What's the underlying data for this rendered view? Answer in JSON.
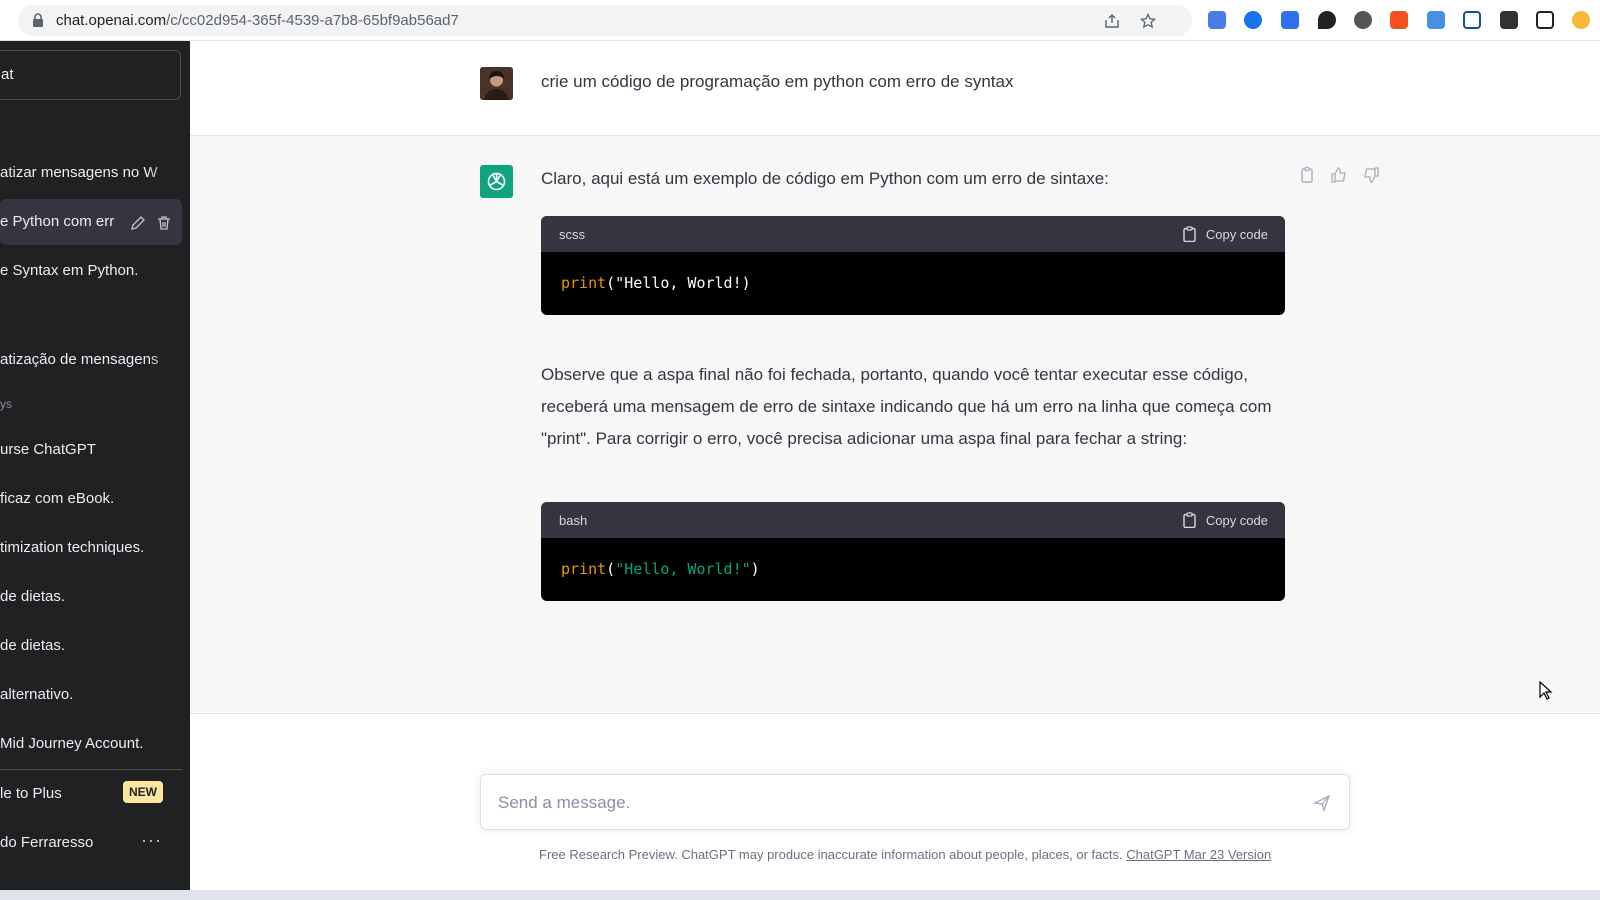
{
  "browser": {
    "url_host": "chat.openai.com",
    "url_path": "/c/cc02d954-365f-4539-a7b8-65bf9ab56ad7"
  },
  "sidebar": {
    "new_chat_label": "at",
    "items": [
      {
        "label": "atizar mensagens no W"
      },
      {
        "label": "e Python com err"
      },
      {
        "label": "e Syntax em Python."
      },
      {
        "label": "atização de mensagens"
      },
      {
        "label": "urse ChatGPT"
      },
      {
        "label": "ficaz com eBook."
      },
      {
        "label": "timization techniques."
      },
      {
        "label": "de dietas."
      },
      {
        "label": "de dietas."
      },
      {
        "label": "alternativo."
      },
      {
        "label": "Mid Journey Account."
      }
    ],
    "group_label": "ys",
    "upgrade_label": "le to Plus",
    "new_badge": "NEW",
    "user_name": "do Ferraresso",
    "more_label": "···"
  },
  "conversation": {
    "user_message": "crie um código de programação em python com erro de syntax",
    "bot_intro": "Claro, aqui está um exemplo de código em Python com um erro de sintaxe:",
    "code1": {
      "lang": "scss",
      "copy_label": "Copy code",
      "fn": "print",
      "rest": "(\"Hello, World!)"
    },
    "bot_paragraph": "Observe que a aspa final não foi fechada, portanto, quando você tentar executar esse código, receberá uma mensagem de erro de sintaxe indicando que há um erro na linha que começa com \"print\". Para corrigir o erro, você precisa adicionar uma aspa final para fechar a string:",
    "code2": {
      "lang": "bash",
      "copy_label": "Copy code",
      "fn": "print",
      "open": "(",
      "str": "\"Hello, World!\"",
      "close": ")"
    }
  },
  "composer": {
    "placeholder": "Send a message.",
    "footer_text": "Free Research Preview. ChatGPT may produce inaccurate information about people, places, or facts. ",
    "footer_link": "ChatGPT Mar 23 Version"
  },
  "colors": {
    "sidebar_bg": "#202123",
    "accent_green": "#10a37f",
    "code_keyword": "#e9950c",
    "code_string": "#00a67d"
  }
}
